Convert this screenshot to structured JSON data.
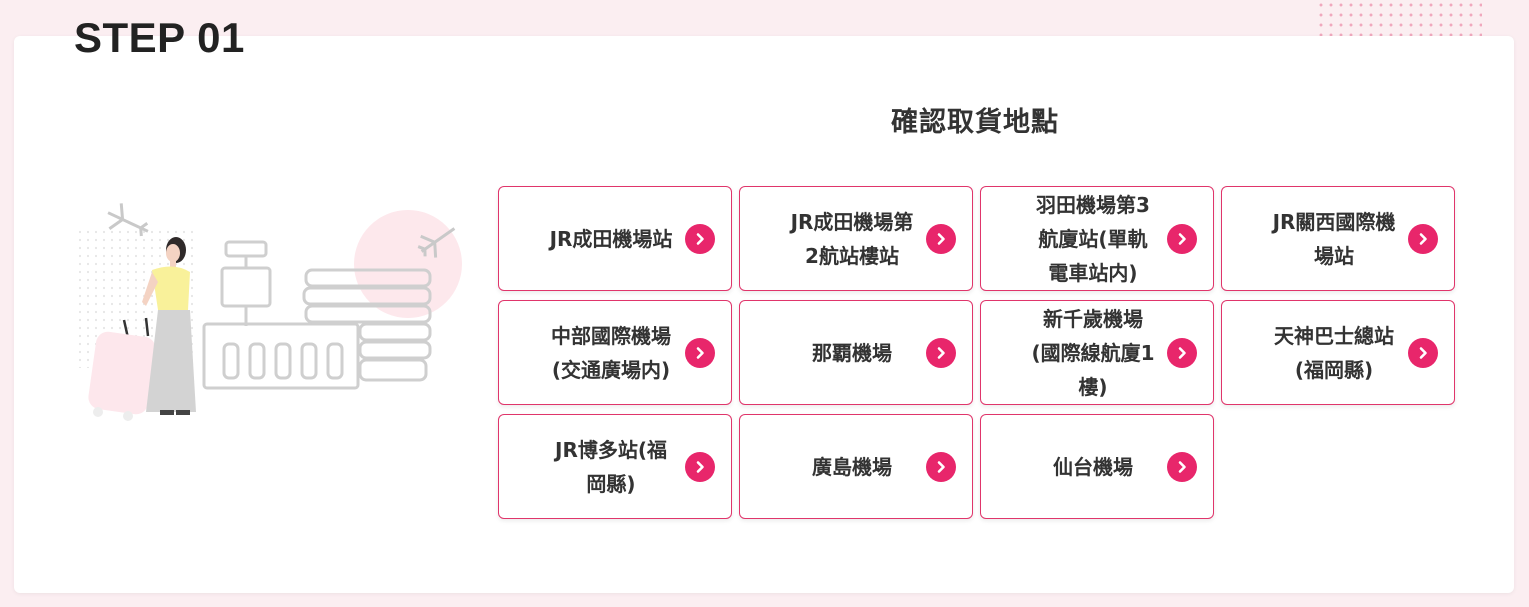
{
  "header": {
    "step_label": "STEP 01"
  },
  "section": {
    "title": "確認取貨地點"
  },
  "colors": {
    "accent": "#e8266b",
    "border": "#e0356b",
    "background": "#fbeef1"
  },
  "locations": [
    {
      "label": "JR成田機場站"
    },
    {
      "label": "JR成田機場第2航站樓站"
    },
    {
      "label": "羽田機場第3航廈站(單軌電車站内)"
    },
    {
      "label": "JR關西國際機場站"
    },
    {
      "label": "中部國際機場(交通廣場内)"
    },
    {
      "label": "那覇機場"
    },
    {
      "label": "新千歲機場(國際線航廈1樓)"
    },
    {
      "label": "天神巴士總站 (福岡縣)"
    },
    {
      "label": "JR博多站(福岡縣)"
    },
    {
      "label": "廣島機場"
    },
    {
      "label": "仙台機場"
    }
  ]
}
